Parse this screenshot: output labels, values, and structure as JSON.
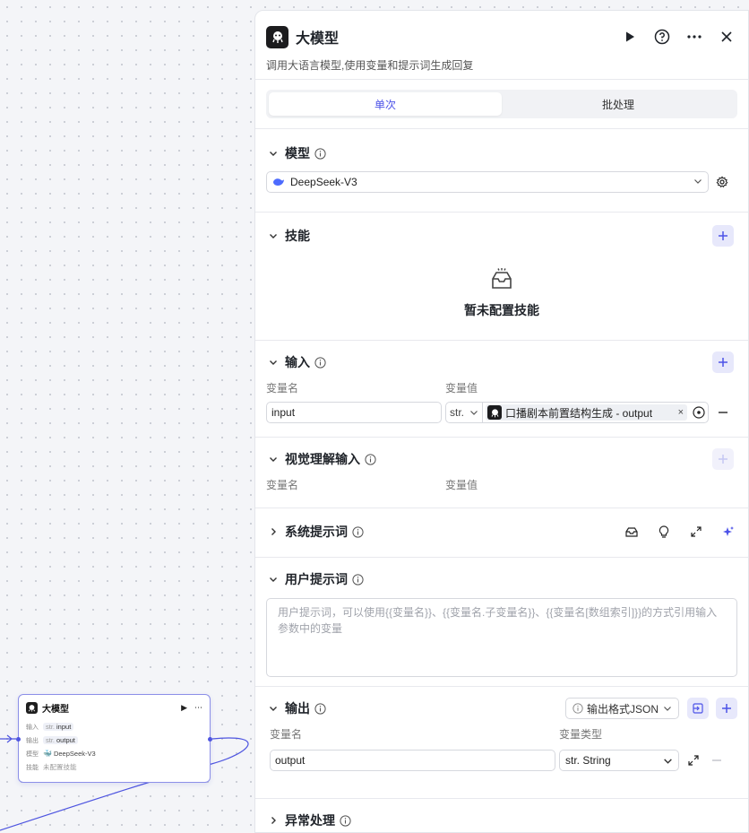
{
  "node": {
    "title": "大模型",
    "rows": [
      {
        "key": "输入",
        "type": "str.",
        "value": "input"
      },
      {
        "key": "输出",
        "type": "str.",
        "value": "output"
      },
      {
        "key": "模型",
        "value": "DeepSeek-V3"
      },
      {
        "key": "技能",
        "value": "未配置技能"
      }
    ]
  },
  "panel": {
    "title": "大模型",
    "description": "调用大语言模型,使用变量和提示词生成回复",
    "tabs": [
      "单次",
      "批处理"
    ],
    "active_tab": "单次"
  },
  "model": {
    "label": "模型",
    "selected": "DeepSeek-V3"
  },
  "skills": {
    "label": "技能",
    "empty_text": "暂未配置技能"
  },
  "input": {
    "label": "输入",
    "col_name": "变量名",
    "col_value": "变量值",
    "row": {
      "name": "input",
      "type": "str.",
      "ref": "口播剧本前置结构生成 - output"
    }
  },
  "vision": {
    "label": "视觉理解输入",
    "col_name": "变量名",
    "col_value": "变量值"
  },
  "system_prompt": {
    "label": "系统提示词"
  },
  "user_prompt": {
    "label": "用户提示词",
    "placeholder": "用户提示词，可以使用{{变量名}}、{{变量名.子变量名}}、{{变量名[数组索引]}}的方式引用输入参数中的变量"
  },
  "output": {
    "label": "输出",
    "format": "输出格式JSON",
    "col_name": "变量名",
    "col_type": "变量类型",
    "row": {
      "name": "output",
      "type": "str. String"
    }
  },
  "error": {
    "label": "异常处理"
  },
  "colors": {
    "accent": "#4d53e8",
    "accent_bg": "#e7e8fb",
    "edge": "#4e55e0"
  }
}
